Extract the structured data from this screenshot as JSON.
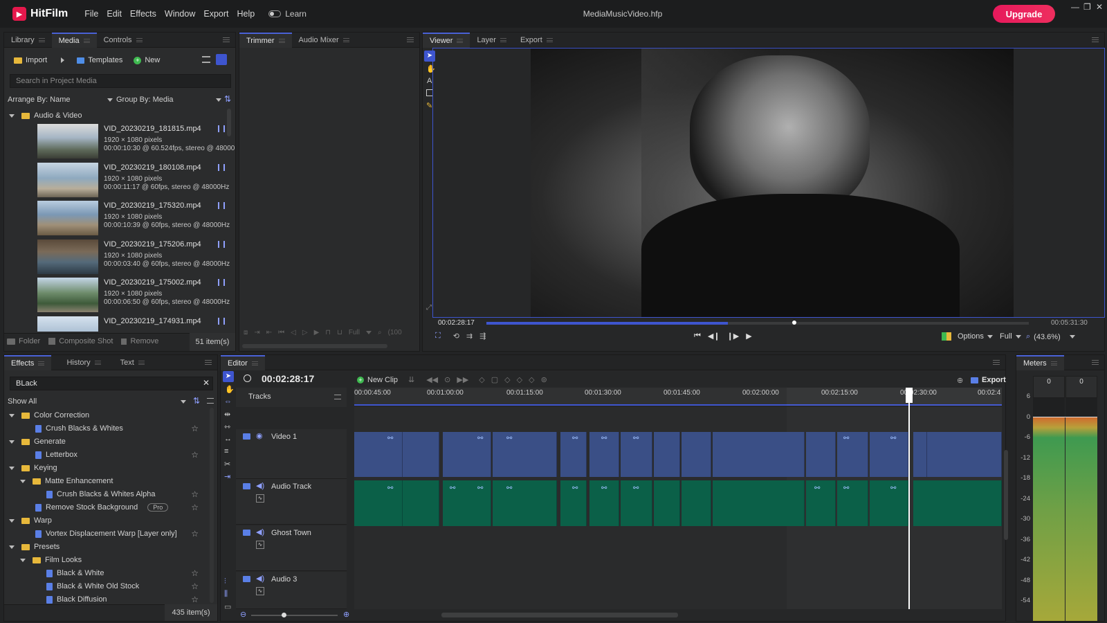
{
  "app": {
    "name": "HitFilm",
    "menu": [
      "File",
      "Edit",
      "Effects",
      "Window",
      "Export",
      "Help"
    ],
    "learn_label": "Learn",
    "document_title": "MediaMusicVideo.hfp",
    "upgrade_label": "Upgrade",
    "accent": "#4a62d8",
    "brand": "#e5184c"
  },
  "media_panel": {
    "tabs": [
      "Library",
      "Media",
      "Controls"
    ],
    "import_label": "Import",
    "templates_label": "Templates",
    "new_label": "New",
    "search_placeholder": "Search in Project Media",
    "arrange_by": "Arrange By: Name",
    "group_by": "Group By: Media",
    "folder_name": "Audio & Video",
    "items": [
      {
        "name": "VID_20230219_181815.mp4",
        "res": "1920 × 1080 pixels",
        "info": "00:00:10:30 @ 60.524fps, stereo @ 48000"
      },
      {
        "name": "VID_20230219_180108.mp4",
        "res": "1920 × 1080 pixels",
        "info": "00:00:11:17 @ 60fps, stereo @ 48000Hz"
      },
      {
        "name": "VID_20230219_175320.mp4",
        "res": "1920 × 1080 pixels",
        "info": "00:00:10:39 @ 60fps, stereo @ 48000Hz"
      },
      {
        "name": "VID_20230219_175206.mp4",
        "res": "1920 × 1080 pixels",
        "info": "00:00:03:40 @ 60fps, stereo @ 48000Hz"
      },
      {
        "name": "VID_20230219_175002.mp4",
        "res": "1920 × 1080 pixels",
        "info": "00:00:06:50 @ 60fps, stereo @ 48000Hz"
      },
      {
        "name": "VID_20230219_174931.mp4",
        "res": "1920 × 1080 pixels",
        "info": ""
      }
    ],
    "footer_folder": "Folder",
    "footer_composite": "Composite Shot",
    "footer_remove": "Remove",
    "footer_count": "51 item(s)"
  },
  "trimmer_panel": {
    "tabs": [
      "Trimmer",
      "Audio Mixer"
    ],
    "full_label": "Full",
    "zoom_label": "(100"
  },
  "viewer_panel": {
    "tabs": [
      "Viewer",
      "Layer",
      "Export"
    ],
    "current_time": "00:02:28:17",
    "end_time": "00:05:31:30",
    "playhead_fraction": 0.445,
    "options_label": "Options",
    "full_label": "Full",
    "zoom_label": "(43.6%)"
  },
  "effects_panel": {
    "tabs": [
      "Effects",
      "History",
      "Text"
    ],
    "search_value": "BLack",
    "show_all": "Show All",
    "tree": [
      {
        "label": "Color Correction",
        "type": "folder",
        "level": 0
      },
      {
        "label": "Crush Blacks & Whites",
        "type": "effect",
        "level": 1
      },
      {
        "label": "Generate",
        "type": "folder",
        "level": 0
      },
      {
        "label": "Letterbox",
        "type": "effect",
        "level": 1
      },
      {
        "label": "Keying",
        "type": "folder",
        "level": 0
      },
      {
        "label": "Matte Enhancement",
        "type": "folder",
        "level": 1
      },
      {
        "label": "Crush Blacks & Whites Alpha",
        "type": "effect",
        "level": 2
      },
      {
        "label": "Remove Stock Background",
        "type": "effect",
        "level": 1,
        "badge": "Pro"
      },
      {
        "label": "Warp",
        "type": "folder",
        "level": 0
      },
      {
        "label": "Vortex Displacement Warp [Layer only]",
        "type": "effect",
        "level": 1
      },
      {
        "label": "Presets",
        "type": "folder",
        "level": 0
      },
      {
        "label": "Film Looks",
        "type": "folder",
        "level": 1
      },
      {
        "label": "Black & White",
        "type": "effect",
        "level": 2
      },
      {
        "label": "Black & White Old Stock",
        "type": "effect",
        "level": 2
      },
      {
        "label": "Black Diffusion",
        "type": "effect",
        "level": 2
      }
    ],
    "footer_count": "435 item(s)"
  },
  "editor_panel": {
    "tab": "Editor",
    "timecode": "00:02:28:17",
    "new_clip_label": "New Clip",
    "export_label": "Export",
    "tracks_label": "Tracks",
    "ruler": [
      "00:00:45:00",
      "00:01:00:00",
      "00:01:15:00",
      "00:01:30:00",
      "00:01:45:00",
      "00:02:00:00",
      "00:02:15:00",
      "00:02:30:00",
      "00:02:4"
    ],
    "tracks": [
      {
        "name": "Video 1",
        "kind": "video"
      },
      {
        "name": "Audio Track",
        "kind": "audio"
      },
      {
        "name": "Ghost Town",
        "kind": "audio"
      },
      {
        "name": "Audio 3",
        "kind": "audio"
      }
    ]
  },
  "meters_panel": {
    "tab": "Meters",
    "left_peak": "0",
    "right_peak": "0",
    "scale": [
      "6",
      "0",
      "-6",
      "-12",
      "-18",
      "-24",
      "-30",
      "-36",
      "-42",
      "-48",
      "-54"
    ]
  }
}
